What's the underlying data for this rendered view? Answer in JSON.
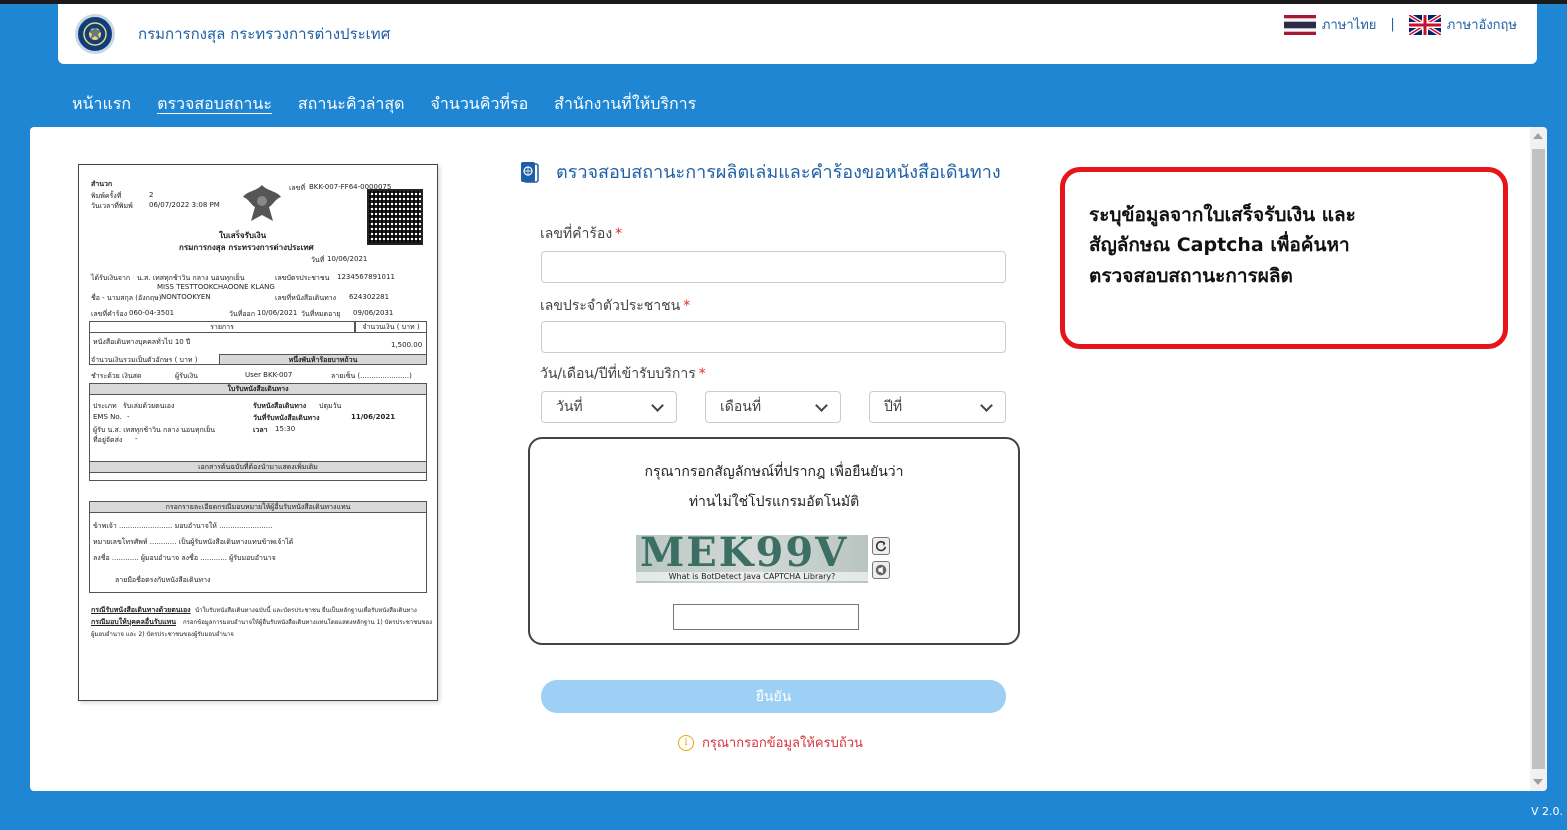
{
  "header": {
    "dept_name": "กรมการกงสุล กระทรวงการต่างประเทศ",
    "lang_th": "ภาษาไทย",
    "lang_sep": "|",
    "lang_en": "ภาษาอังกฤษ"
  },
  "nav": {
    "items": [
      "หน้าแรก",
      "ตรวจสอบสถานะ",
      "สถานะคิวล่าสุด",
      "จำนวนคิวที่รอ",
      "สำนักงานที่ให้บริการ"
    ],
    "active": "ตรวจสอบสถานะ"
  },
  "receipt": {
    "title": "ใบเสร็จรับเงิน",
    "org": "กรมการกงสุล กระทรวงการต่างประเทศ",
    "label_office": "สำนวก",
    "label_print": "พิมพ์ครั้งที่",
    "print_count": "2",
    "label_print_date": "วันเวลาที่พิมพ์",
    "print_date": "06/07/2022 3:08 PM",
    "no_label": "เลขที่",
    "no": "BKK-007-FF64-0000075",
    "date_label": "วันที่",
    "date": "10/06/2021",
    "received_from": "ได้รับเงินจาก",
    "payer_th": "น.ส. เทสทุกช้าวิน กลาง นอนทุกเย็น",
    "payer_en": "MISS TESTTOOKCHAOONE KLANG",
    "id_label": "เลขบัตรประชาชน",
    "id": "1234567891011",
    "name_label": "ชื่อ - นามสกุล (อังกฤษ)",
    "name_en": "NONTOOKYEN",
    "passport_label": "เลขที่หนังสือเดินทาง",
    "passport": "624302281",
    "req_label": "เลขที่คำร้อง",
    "req_no": "060-04-3501",
    "issue_label": "วันที่ออก",
    "issue": "10/06/2021",
    "expire_label": "วันที่หมดอายุ",
    "expire": "09/06/2031",
    "col_item": "รายการ",
    "col_amount": "จำนวนเงิน ( บาท )",
    "item1": "หนังสือเดินทางบุคคลทั่วไป 10 ปี",
    "amount1": "1,500.00",
    "total_words_label": "จำนวนเงินรวมเป็นตัวอักษร ( บาท )",
    "total_words": "หนึ่งพันห้าร้อยบาทถ้วน",
    "pay_by": "ชำระด้วย เงินสด",
    "cashier": "ผู้รับเงิน",
    "user": "User BKK-007",
    "sign": "ลายเซ็น (......................)",
    "pickup_title": "ใบรับหนังสือเดินทาง",
    "pickup_type_label": "ประเภท",
    "pickup_type": "รับเล่มด้วยตนเอง",
    "pickup_place_label": "รับหนังสือเดินทาง",
    "pickup_place": "ปตุมวัน",
    "ems_label": "EMS No.",
    "ems": "-",
    "pickup_date_label": "วันที่รับหนังสือเดินทาง",
    "pickup_date": "11/06/2021",
    "recipient": "ผู้รับ น.ส. เทสทุกช้าวิน กลาง นอนทุกเย็น",
    "time_label": "เวลา",
    "time": "15:30",
    "address_label": "ที่อยู่จัดส่ง",
    "address": "-",
    "docs_title": "เอกสารต้นฉบับที่ต้องนำมาแสดงเพิ่มเติม",
    "proxy_title": "กรอกรายละเอียดกรณีมอบหมายให้ผู้อื่นรับหนังสือเดินทางแทน",
    "proxy_line1": "ข้าพเจ้า ........................ มอบอำนาจให้ ........................",
    "proxy_line2": "หมายเลขโทรศัพท์ ............ เป็นผู้รับหนังสือเดินทางแทนข้าพเจ้าได้",
    "proxy_line3": "ลงชื่อ ............ ผู้มอบอำนาจ   ลงชื่อ ............ ผู้รับมอบอำนาจ",
    "proxy_line4": "ลายมือชื่อตรงกับหนังสือเดินทาง",
    "foot1_label": "กรณีรับหนังสือเดินทางด้วยตนเอง",
    "foot1": "นำใบรับหนังสือเดินทางฉบับนี้ และบัตรประชาชน ยื่นเป็นหลักฐานเพื่อรับหนังสือเดินทาง",
    "foot2_label": "กรณีมอบให้บุคคลอื่นรับแทน",
    "foot2": "กรอกข้อมูลการมอบอำนาจให้ผู้อื่นรับหนังสือเดินทางแทนโดยแสดงหลักฐาน 1) บัตรประชาชนของ",
    "foot3": "ผู้มอบอำนาจ และ 2) บัตรประชาชนของผู้รับมอบอำนาจ"
  },
  "form": {
    "title": "ตรวจสอบสถานะการผลิตเล่มและคำร้องขอหนังสือเดินทาง",
    "req_label": "เลขที่คำร้อง",
    "id_label": "เลขประจำตัวประชาชน",
    "date_label": "วัน/เดือน/ปีที่เข้ารับบริการ",
    "required_mark": "*",
    "day_select": "วันที่",
    "month_select": "เดือนที่",
    "year_select": "ปีที่",
    "req_value": "",
    "id_value": "",
    "captcha_value": "",
    "captcha_prompt_1": "กรุณากรอกสัญลักษณ์ที่ปรากฎ เพื่อยืนยันว่า",
    "captcha_prompt_2": "ท่านไม่ใช่โปรแกรมอัตโนมัติ",
    "captcha_text": "MEK99V",
    "captcha_caption": "What is BotDetect Java CAPTCHA Library?",
    "submit": "ยืนยัน",
    "warning": "กรุณากรอกข้อมูลให้ครบถ้วน"
  },
  "note": {
    "line1": "ระบุข้อมูลจากใบเสร็จรับเงิน และ",
    "line2": "สัญลักษณ Captcha เพื่อค้นหา",
    "line3": "ตรวจสอบสถานะการผลิต"
  },
  "version": "V 2.0.",
  "colors": {
    "page_bg": "#1f86d4",
    "accent": "#1e5fa6",
    "submit_bg": "#9dd0f4",
    "note_border": "#e8141c",
    "warning": "#d6343b"
  }
}
